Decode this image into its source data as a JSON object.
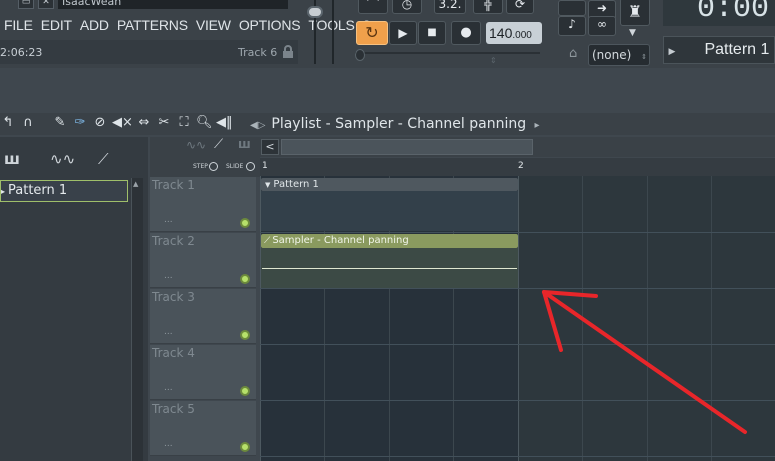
{
  "window": {
    "user": "IsaacWean",
    "min_glyph": "▭",
    "close_glyph": "✕"
  },
  "menu": [
    "FILE",
    "EDIT",
    "ADD",
    "PATTERNS",
    "VIEW",
    "OPTIONS",
    "TOOLS",
    "?"
  ],
  "hint": {
    "time": "2:06:23",
    "track": "Track 6"
  },
  "transport": {
    "top_icons": [
      "metronome-icon",
      "clock-icon",
      "3.2.",
      "step-icon",
      "loop-record-icon"
    ],
    "top_icon_text": "3.2.",
    "loop_glyph": "↻",
    "play_glyph": "▶",
    "stop_glyph": "■",
    "record_glyph": "●",
    "tempo_whole": "140",
    "tempo_frac": ".000"
  },
  "snap": {
    "value": "(none)"
  },
  "time_display": "0:00:",
  "pattern_selector": {
    "value": "Pattern 1"
  },
  "playlist": {
    "title": "Playlist - Sampler - Channel panning",
    "step_label": "STEP",
    "slide_label": "SLIDE"
  },
  "picker": {
    "pattern_entry": "Pattern 1"
  },
  "ruler": {
    "marks": [
      "1",
      "2"
    ]
  },
  "tracks": [
    {
      "name": "Track 1",
      "dots": "..."
    },
    {
      "name": "Track 2",
      "dots": "..."
    },
    {
      "name": "Track 3",
      "dots": "..."
    },
    {
      "name": "Track 4",
      "dots": "..."
    },
    {
      "name": "Track 5",
      "dots": "..."
    }
  ],
  "clips": {
    "pattern_clip": "Pattern 1",
    "automation_clip": "Sampler - Channel panning"
  },
  "annotation": {
    "arrow_color": "#e8262a"
  },
  "colors": {
    "loop_accent": "#f0a04b",
    "led_green": "#b6e06a",
    "automation_clip": "#8a9a5f"
  }
}
